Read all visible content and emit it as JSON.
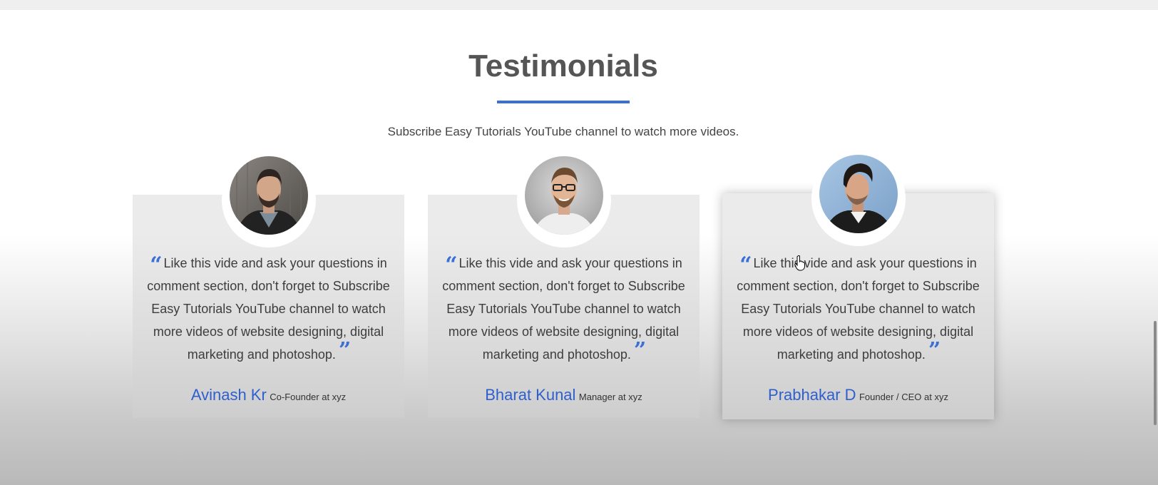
{
  "section": {
    "title": "Testimonials",
    "subtitle": "Subscribe Easy Tutorials YouTube channel to watch more videos.",
    "accent_color": "#3a6fd8"
  },
  "testimonials": [
    {
      "quote": "Like this vide and ask your questions in comment section, don't forget to Subscribe Easy Tutorials YouTube channel to watch more videos of website designing, digital marketing and photoshop.",
      "name": "Avinash Kr",
      "role": "Co-Founder at xyz",
      "avatar_icon": "man-with-beard-photo"
    },
    {
      "quote": "Like this vide and ask your questions in comment section, don't forget to Subscribe Easy Tutorials YouTube channel to watch more videos of website designing, digital marketing and photoshop.",
      "name": "Bharat Kunal",
      "role": "Manager at xyz",
      "avatar_icon": "man-with-glasses-photo"
    },
    {
      "quote": "Like this vide and ask your questions in comment section, don't forget to Subscribe Easy Tutorials YouTube channel to watch more videos of website designing, digital marketing and photoshop.",
      "name": "Prabhakar D",
      "role": "Founder / CEO at xyz",
      "avatar_icon": "man-side-profile-photo"
    }
  ],
  "quote_marks": {
    "open": "“",
    "close": "”"
  }
}
